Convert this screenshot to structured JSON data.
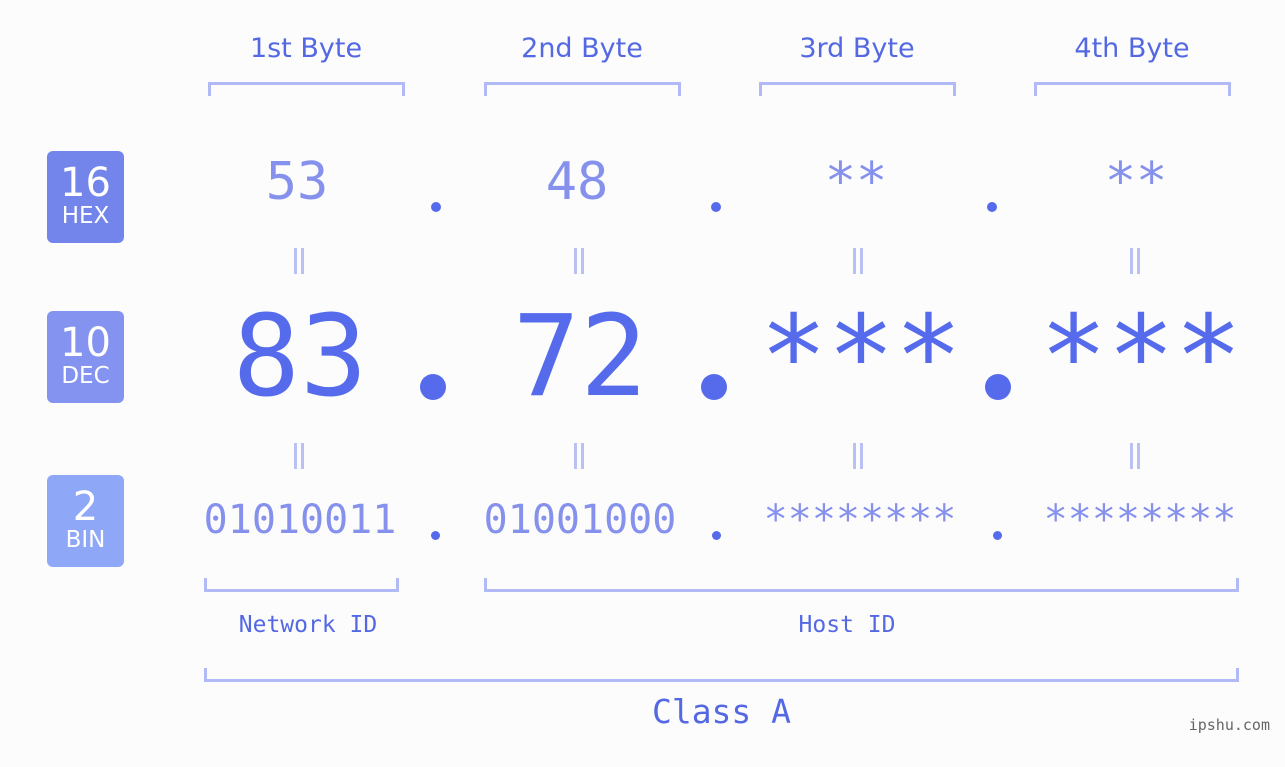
{
  "bytes": {
    "headers": [
      "1st Byte",
      "2nd Byte",
      "3rd Byte",
      "4th Byte"
    ]
  },
  "badges": {
    "hex": {
      "number": "16",
      "label": "HEX",
      "color": "#7385ea"
    },
    "dec": {
      "number": "10",
      "label": "DEC",
      "color": "#8493ef"
    },
    "bin": {
      "number": "2",
      "label": "BIN",
      "color": "#8fa7f7"
    }
  },
  "hex_values": [
    "53",
    "48",
    "**",
    "**"
  ],
  "dec_values": [
    "83",
    "72",
    "***",
    "***"
  ],
  "bin_values": [
    "01010011",
    "01001000",
    "********",
    "********"
  ],
  "separator": ".",
  "parts": {
    "network_label": "Network ID",
    "host_label": "Host ID",
    "class_label": "Class A"
  },
  "watermark": "ipshu.com",
  "colors": {
    "accent": "#556bec",
    "light": "#8591ec",
    "bracket": "#b1baf6"
  }
}
